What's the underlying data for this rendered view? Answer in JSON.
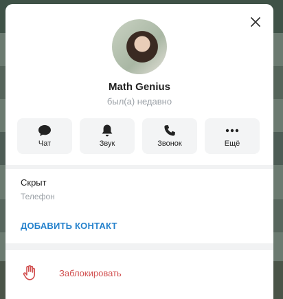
{
  "profile": {
    "name": "Math Genius",
    "status": "был(а) недавно"
  },
  "actions": [
    {
      "label": "Чат",
      "icon": "chat-bubble-icon"
    },
    {
      "label": "Звук",
      "icon": "bell-icon"
    },
    {
      "label": "Звонок",
      "icon": "phone-icon"
    },
    {
      "label": "Ещё",
      "icon": "more-dots-icon"
    }
  ],
  "info": {
    "phone_value": "Скрыт",
    "phone_label": "Телефон"
  },
  "add_contact_label": "ДОБАВИТЬ КОНТАКТ",
  "block_label": "Заблокировать",
  "colors": {
    "accent": "#2481cc",
    "danger": "#d14e4e"
  }
}
